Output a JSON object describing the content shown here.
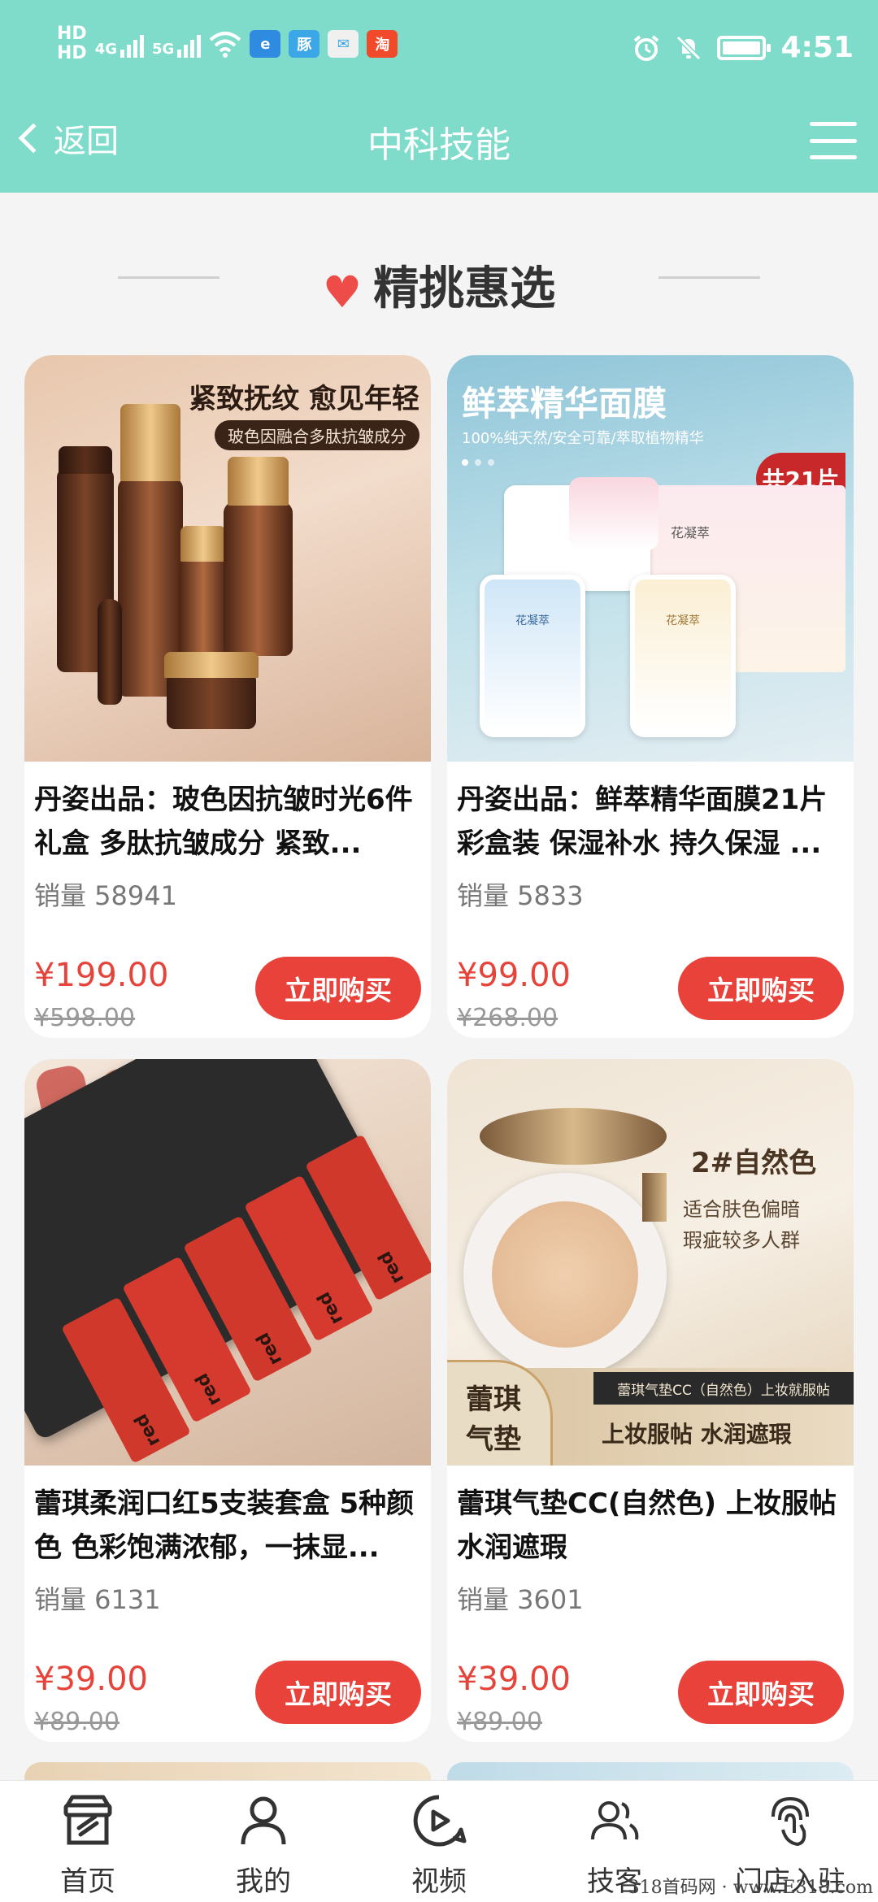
{
  "status_bar": {
    "network_left": "HD",
    "sig1_label": "4G",
    "sig2_label": "5G",
    "time": "4:51",
    "app_icons": [
      "e",
      "豚",
      "✉",
      "淘"
    ]
  },
  "nav": {
    "back_label": "返回",
    "title": "中科技能"
  },
  "section": {
    "title": "精挑惠选"
  },
  "products": [
    {
      "title": "丹姿出品：玻色因抗皱时光6件礼盒 多肽抗皱成分 紧致...",
      "sales": "销量 58941",
      "price": "¥199.00",
      "old_price": "¥598.00",
      "buy_label": "立即购买",
      "image_heading": "紧致抚纹 愈见年轻",
      "image_tag": "玻色因融合多肽抗皱成分"
    },
    {
      "title": "丹姿出品：鲜萃精华面膜21片彩盒装 保湿补水 持久保湿 ...",
      "sales": "销量 5833",
      "price": "¥99.00",
      "old_price": "¥268.00",
      "buy_label": "立即购买",
      "image_heading": "鲜萃精华面膜",
      "image_sub": "100%纯天然/安全可靠/萃取植物精华",
      "image_badge": "共21片",
      "image_brand": "花凝萃"
    },
    {
      "title": "蕾琪柔润口红5支装套盒 5种颜色 色彩饱满浓郁，一抹显...",
      "sales": "销量 6131",
      "price": "¥39.00",
      "old_price": "¥89.00",
      "buy_label": "立即购买",
      "image_print": "red"
    },
    {
      "title": "蕾琪气垫CC(自然色) 上妆服帖 水润遮瑕",
      "sales": "销量 3601",
      "price": "¥39.00",
      "old_price": "¥89.00",
      "buy_label": "立即购买",
      "image_heading": "2#自然色",
      "image_line1": "适合肤色偏暗",
      "image_line2": "瑕疵较多人群",
      "image_badge_line1": "蕾琪",
      "image_badge_line2": "气垫",
      "image_strip": "蕾琪气垫CC（自然色）上妆就服帖",
      "image_slogan": "上妆服帖 水润遮瑕"
    }
  ],
  "tabbar": [
    {
      "label": "首页",
      "icon": "store-icon"
    },
    {
      "label": "我的",
      "icon": "user-icon"
    },
    {
      "label": "视频",
      "icon": "video-icon"
    },
    {
      "label": "技客",
      "icon": "users-icon"
    },
    {
      "label": "门店入驻",
      "icon": "fingerprint-icon"
    }
  ],
  "watermark": "318首码网 · www.E318.com",
  "colors": {
    "header": "#7fdccb",
    "accent_red": "#e9423a",
    "price_red": "#e6443a"
  }
}
